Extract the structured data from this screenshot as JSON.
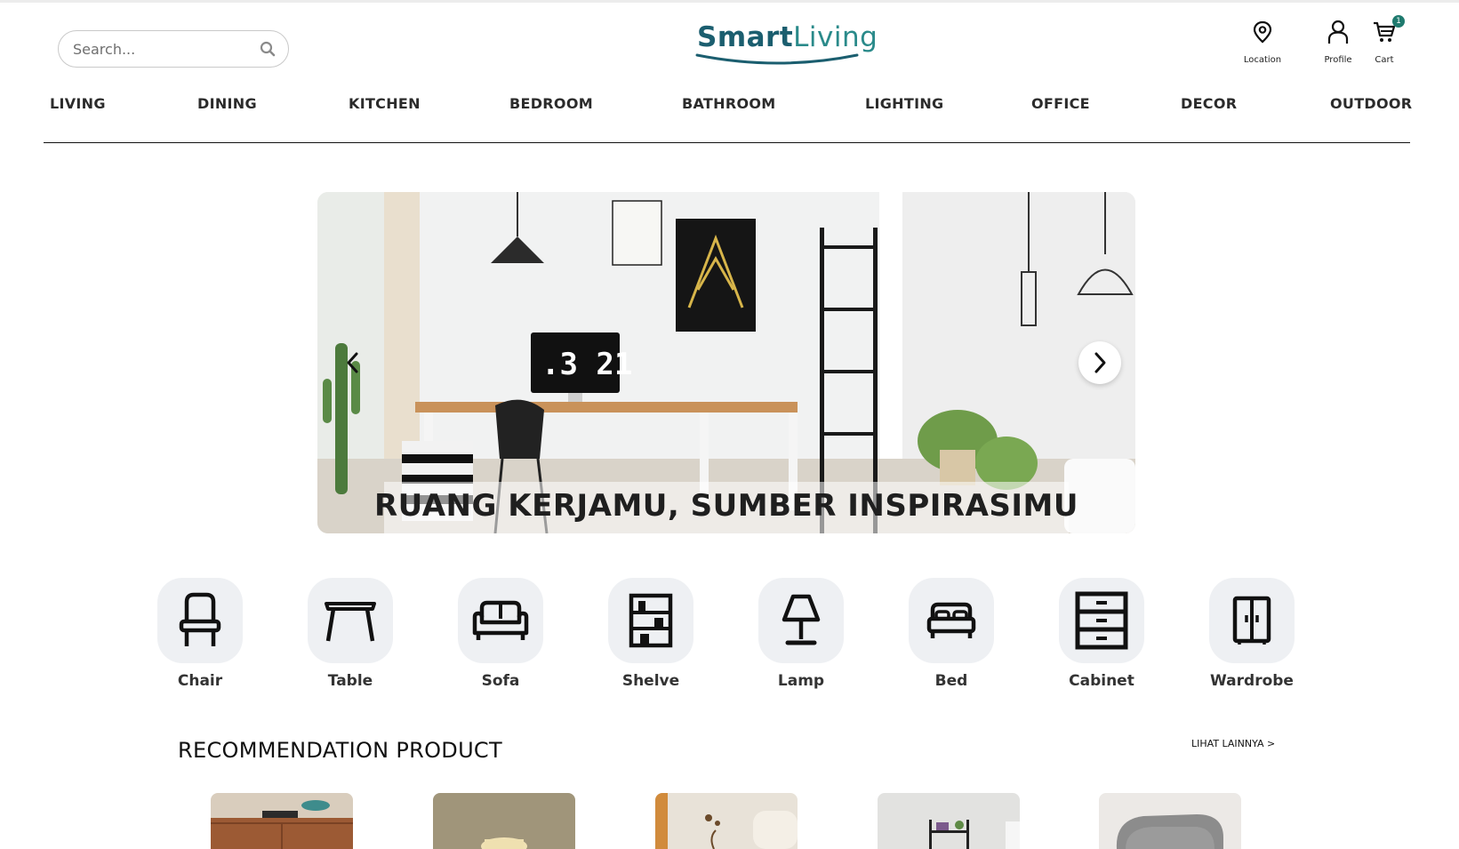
{
  "header": {
    "search_placeholder": "Search...",
    "logo": {
      "part1": "Smart",
      "part2": "Living"
    },
    "actions": {
      "location_label": "Location",
      "profile_label": "Profile",
      "cart_label": "Cart",
      "cart_count": "1"
    }
  },
  "nav": {
    "items": [
      "LIVING",
      "DINING",
      "KITCHEN",
      "BEDROOM",
      "BATHROOM",
      "LIGHTING",
      "OFFICE",
      "DECOR",
      "OUTDOOR"
    ]
  },
  "hero": {
    "caption": "RUANG KERJAMU, SUMBER INSPIRASIMU",
    "clock_text": ".3 21"
  },
  "categories": {
    "items": [
      {
        "label": "Chair",
        "icon": "chair-icon"
      },
      {
        "label": "Table",
        "icon": "table-icon"
      },
      {
        "label": "Sofa",
        "icon": "sofa-icon"
      },
      {
        "label": "Shelve",
        "icon": "shelve-icon"
      },
      {
        "label": "Lamp",
        "icon": "lamp-icon"
      },
      {
        "label": "Bed",
        "icon": "bed-icon"
      },
      {
        "label": "Cabinet",
        "icon": "cabinet-icon"
      },
      {
        "label": "Wardrobe",
        "icon": "wardrobe-icon"
      }
    ]
  },
  "recommendation": {
    "title": "RECOMMENDATION PRODUCT",
    "see_more": "LIHAT LAINNYA >"
  },
  "colors": {
    "brand_dark": "#1b5e6f",
    "brand_light": "#2a8a8a",
    "badge": "#1f7a6e",
    "tile_bg": "#eef0f3"
  }
}
